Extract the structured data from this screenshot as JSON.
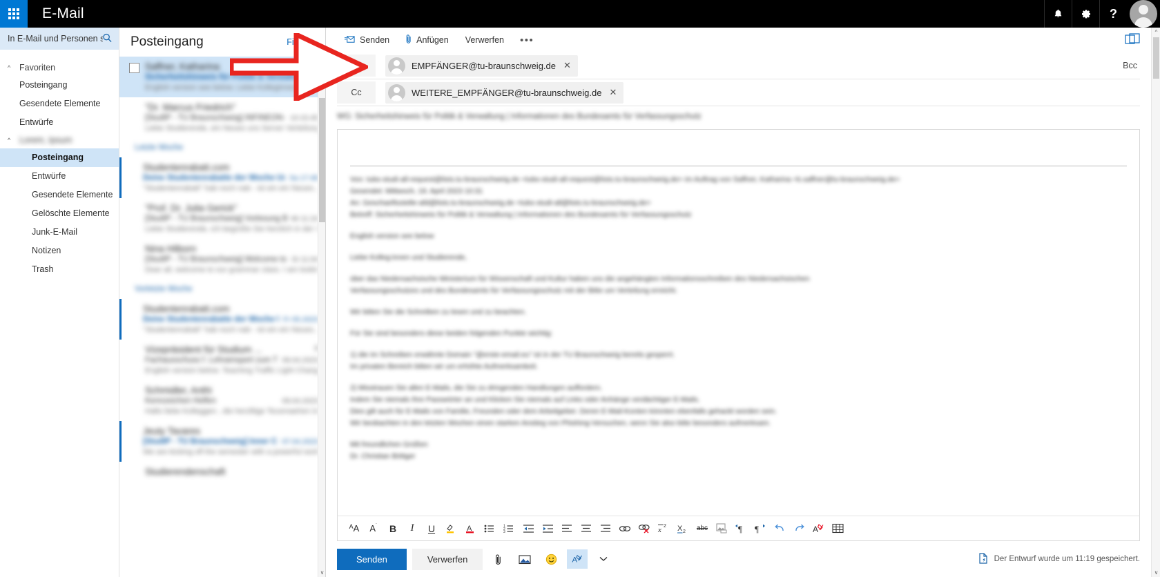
{
  "topbar": {
    "app_title": "E-Mail",
    "waffle_name": "app-launcher",
    "notifications_icon": " 🔔",
    "settings_icon": "⚙",
    "help_icon": "?"
  },
  "search": {
    "placeholder": "In E-Mail und Personen s...",
    "icon": "⚲"
  },
  "sidebar": {
    "favorites": {
      "label": "Favoriten",
      "items": [
        {
          "label": "Posteingang"
        },
        {
          "label": "Gesendete Elemente"
        },
        {
          "label": "Entwürfe"
        }
      ]
    },
    "account": {
      "label": "Lorem, Ipsum",
      "blurred": true,
      "items": [
        {
          "label": "Posteingang",
          "active": true
        },
        {
          "label": "Entwürfe",
          "active": false
        },
        {
          "label": "Gesendete Elemente",
          "active": false
        },
        {
          "label": "Gelöschte Elemente",
          "active": false
        },
        {
          "label": "Junk-E-Mail",
          "active": false
        },
        {
          "label": "Notizen",
          "active": false
        },
        {
          "label": "Trash",
          "active": false
        }
      ]
    }
  },
  "messagelist": {
    "title": "Posteingang",
    "filter_label": "Filter",
    "filter_chevron": "⌄",
    "groups": [
      {
        "type": "label",
        "label": "Letzte Woche"
      },
      {
        "type": "label",
        "label": "Vorletzte Woche"
      }
    ],
    "messages": [
      {
        "from": "Saffner, Katharina",
        "subject": "Sicherheitshinweis für Politik & Verwaltu.",
        "preview": "English version see below. Liebe Kolleginnen und Studi...",
        "date": "11:09",
        "selected": true,
        "unread": false,
        "checkbox": true,
        "blurred": true
      },
      {
        "from": "\"Dr. Marcus Friedrich\"",
        "subject": "[StudIP - TU Braunschweig] INFINEON-P.",
        "preview": "Liebe Studierende, ein Neues uns Server Verteilung ...",
        "date": "10:15:45",
        "selected": false,
        "unread": false,
        "checkbox": false,
        "blurred": true
      },
      {
        "type": "group",
        "label": "Letzte Woche"
      },
      {
        "from": "Studentenrabatt.com",
        "subject": "Deine Studentenrabatte der Woche Udf",
        "preview": "\"Studentenrabatt\" hab noch nab - ist ein ein Neues...",
        "date": "Sa 17:48",
        "selected": false,
        "unread": true,
        "checkbox": false,
        "blurred": true
      },
      {
        "from": "\"Prof. Dr. Julia Gerick\"",
        "subject": "[StudIP - TU Braunschweig] Vorlesung B.",
        "preview": "Liebe Studierende, ich begrüße Sie herzlich in der 30...",
        "date": "Mi 11:24",
        "selected": false,
        "unread": false,
        "checkbox": false,
        "blurred": true
      },
      {
        "from": "Nina Hilborn",
        "subject": "[StudIP - TU Braunschweig] Welcome to",
        "preview": "Dear all, welcome to our grammar class. I am looking...",
        "date": "Di 11:04",
        "selected": false,
        "unread": false,
        "checkbox": false,
        "blurred": true
      },
      {
        "type": "group",
        "label": "Vorletzte Woche"
      },
      {
        "from": "Studentenrabatt.com",
        "subject": "Deine Studentenrabatte der Woche Udf",
        "preview": "\"Studentenrabatt\" hab noch nab - ist ein ein Neues...",
        "date": "Fr 05.2023",
        "selected": false,
        "unread": true,
        "checkbox": false,
        "blurred": true
      },
      {
        "from": "Vizepräsident für Studium ...",
        "subject": "Fachausschuss f. Lehramspert zum TEACH",
        "preview": "English version below. Teaching Traffic Light Chang...",
        "date": "09.04.2023",
        "count": "3",
        "selected": false,
        "unread": false,
        "checkbox": false,
        "blurred": true
      },
      {
        "from": "Schmidler, Anthi",
        "subject": "Kennzeichen Helfen",
        "preview": "Hallo liebe Kolleggen , die herzlliige Teusmaehen in C...",
        "date": "09.04.2023",
        "selected": false,
        "unread": false,
        "checkbox": false,
        "blurred": true
      },
      {
        "from": "Jeuty Tavares",
        "subject": "[StudIP - TU Braunschweig] Inner Critic",
        "preview": "We are kicking off the semester with a powerful work...",
        "date": "07.04.2023",
        "selected": false,
        "unread": true,
        "checkbox": false,
        "blurred": true
      },
      {
        "from": "Studierendenschaft",
        "subject": "",
        "preview": "",
        "date": "",
        "selected": false,
        "unread": false,
        "checkbox": false,
        "blurred": true
      }
    ]
  },
  "compose": {
    "commands": [
      {
        "name": "send",
        "label": "Senden",
        "icon": "✉"
      },
      {
        "name": "attach",
        "label": "Anfügen",
        "icon": "📎"
      },
      {
        "name": "discard",
        "label": "Verwerfen",
        "icon": ""
      },
      {
        "name": "more",
        "label": "•••",
        "icon": ""
      }
    ],
    "popout_icon": "popout-icon",
    "to": {
      "label": "An",
      "recipient": "EMPFÄNGER@tu-braunschweig.de",
      "remove_icon": "✕"
    },
    "cc": {
      "label": "Cc",
      "recipient": "WEITERE_EMPFÄNGER@tu-braunschweig.de",
      "remove_icon": "✕"
    },
    "bcc_label": "Bcc",
    "subject": "WG: Sicherheitshinweis für Politik & Verwaltung | Informationen des Bundesamts für Verfassungsschutz",
    "body_lines": [
      {
        "text": "",
        "type": "gap"
      },
      {
        "text": "",
        "type": "hr"
      },
      {
        "text": "Von: tubs-studi-all-request@lists.tu-braunschweig.de <tubs-studi-all-request@lists.tu-braunschweig.de> im Auftrag von Saffner, Katharina <k.saffner@tu-braunschweig.de>",
        "type": "head"
      },
      {
        "text": "Gesendet: Mittwoch, 19. April 2023 10:31",
        "type": "head"
      },
      {
        "text": "An: Geschaeftsstelle-afd@lists.tu-braunschweig.de <tubs-studi-all@lists.tu-braunschweig.de>",
        "type": "head"
      },
      {
        "text": "Betreff: Sicherheitshinweis für Politik & Verwaltung | Informationen des Bundesamts für Verfassungsschutz",
        "type": "head"
      },
      {
        "text": "",
        "type": "gap"
      },
      {
        "text": "English version see below",
        "type": "p"
      },
      {
        "text": "",
        "type": "gap"
      },
      {
        "text": "Liebe Kolleg:innen und Studierende,",
        "type": "p"
      },
      {
        "text": "",
        "type": "gap"
      },
      {
        "text": "über das Niedersachsische Ministerium für Wissenschaft und Kultur haben uns die angehängten Informationsschreiben des Niedersachsischen",
        "type": "p"
      },
      {
        "text": "Verfassungsschutzes und des Bundesamts für Verfassungsschutz mit der Bitte um Verteilung erreicht.",
        "type": "p"
      },
      {
        "text": "",
        "type": "gap"
      },
      {
        "text": "Wir bitten Sie die Schreiben zu lesen und zu beachten.",
        "type": "p"
      },
      {
        "text": "",
        "type": "gap"
      },
      {
        "text": "Für Sie sind besonders diese beiden folgenden Punkte wichtig:",
        "type": "p"
      },
      {
        "text": "",
        "type": "gap"
      },
      {
        "text": "1) die im Schreiben erwähnte Domain \"@erste-email.eu\" ist in der TU Braunschweig bereits gesperrt.",
        "type": "p"
      },
      {
        "text": "Im privaten Bereich bitten wir um erhöhte Aufmerksamkeit.",
        "type": "p"
      },
      {
        "text": "",
        "type": "gap"
      },
      {
        "text": "2) Misstrauen Sie allen E-Mails, die Sie zu dringenden Handlungen auffordern.",
        "type": "p"
      },
      {
        "text": "Indem Sie niemals Ihre Passwörter an und Klicken Sie niemals auf Links oder Anhänge verdächtiger E-Mails.",
        "type": "p"
      },
      {
        "text": "Dies gilt auch für E-Mails von Familie, Freunden oder dem Arbeitgeber. Deren E-Mail-Konten könnten ebenfalls gehackt worden sein.",
        "type": "p"
      },
      {
        "text": "Wir beobachten in den letzten Wochen einen starken Anstieg von Phishing-Versuchen, wenn Sie also bitte besonders aufmerksam.",
        "type": "p"
      },
      {
        "text": "",
        "type": "gap"
      },
      {
        "text": "Mit freundlichen Grüßen",
        "type": "p"
      },
      {
        "text": "Dr. Christian Böttger",
        "type": "p"
      }
    ],
    "format_tools": [
      {
        "name": "font-size-grow-icon",
        "glyph": "Aᴀ",
        "style": ""
      },
      {
        "name": "font-size-shrink-icon",
        "glyph": "A˙",
        "style": ""
      },
      {
        "name": "bold-icon",
        "glyph": "B",
        "style": "bold"
      },
      {
        "name": "italic-icon",
        "glyph": "I",
        "style": "italic"
      },
      {
        "name": "underline-icon",
        "glyph": "U",
        "style": "underline"
      },
      {
        "name": "highlight-color-icon",
        "glyph": "✐",
        "style": "highlight"
      },
      {
        "name": "font-color-icon",
        "glyph": "A",
        "style": "fontcolor"
      },
      {
        "name": "bulleted-list-icon",
        "glyph": "☰",
        "style": ""
      },
      {
        "name": "numbered-list-icon",
        "glyph": "☰",
        "style": ""
      },
      {
        "name": "decrease-indent-icon",
        "glyph": "⇤",
        "style": ""
      },
      {
        "name": "increase-indent-icon",
        "glyph": "⇥",
        "style": ""
      },
      {
        "name": "align-left-icon",
        "glyph": "≡",
        "style": ""
      },
      {
        "name": "align-center-icon",
        "glyph": "≡",
        "style": ""
      },
      {
        "name": "align-right-icon",
        "glyph": "≡",
        "style": ""
      },
      {
        "name": "insert-link-icon",
        "glyph": "🔗",
        "style": ""
      },
      {
        "name": "remove-link-icon",
        "glyph": "🔗",
        "style": "unlink"
      },
      {
        "name": "superscript-icon",
        "glyph": "x²",
        "style": ""
      },
      {
        "name": "subscript-icon",
        "glyph": "x₂",
        "style": ""
      },
      {
        "name": "strikethrough-icon",
        "glyph": "abc",
        "style": "strike"
      },
      {
        "name": "insert-image-icon",
        "glyph": "🏔",
        "style": "muted"
      },
      {
        "name": "ltr-direction-icon",
        "glyph": "¶",
        "style": "blue"
      },
      {
        "name": "rtl-direction-icon",
        "glyph": "¶",
        "style": "blue"
      },
      {
        "name": "undo-icon",
        "glyph": "↶",
        "style": "blue"
      },
      {
        "name": "redo-icon",
        "glyph": "↷",
        "style": "blue"
      },
      {
        "name": "clear-formatting-icon",
        "glyph": "A",
        "style": "clearfmt"
      },
      {
        "name": "insert-table-icon",
        "glyph": "▦",
        "style": ""
      }
    ],
    "bottom": {
      "send_label": "Senden",
      "discard_label": "Verwerfen",
      "attach_icon": "📎",
      "image_icon": "🏔",
      "emoji_icon": "☺",
      "formatting_icon": "✐",
      "more_chevron": "⌄",
      "saved_text": "Der Entwurf wurde um 11:19 gespeichert.",
      "saved_icon": "🗎"
    }
  },
  "colors": {
    "accent": "#0f6cbd",
    "waffle_blue": "#0078d4",
    "topbar_black": "#000000",
    "selected_row": "#cfe4f7",
    "search_bg": "#dbe9f7",
    "arrow_red": "#e8251f"
  }
}
